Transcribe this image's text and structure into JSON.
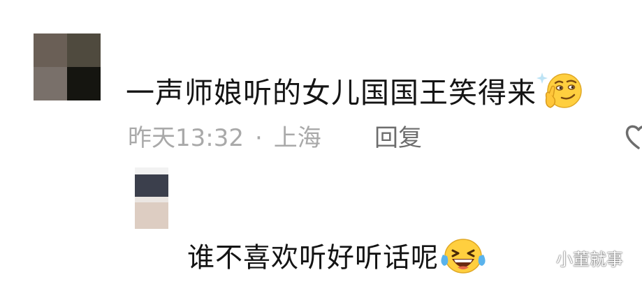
{
  "comment": {
    "avatar": {
      "icon": "pixelated-avatar",
      "pixels": [
        "#6a5f56",
        "#4f4a3e",
        "#79706a",
        "#151510"
      ]
    },
    "text": "一声师娘听的女儿国国王笑得来",
    "emoji": "smirk-thinking-emoji",
    "time": "昨天13:32",
    "separator": "·",
    "location": "上海",
    "reply_label": "回复",
    "like_icon": "heart-outline-icon"
  },
  "reply": {
    "avatar": {
      "icon": "blurred-avatar"
    },
    "text": "谁不喜欢听好听话呢",
    "emoji": "laughing-tears-emoji"
  },
  "watermark": {
    "text": "小董就事"
  },
  "colors": {
    "text_primary": "#141414",
    "text_meta": "#a9a9a9",
    "reply_link": "#6d6d6d",
    "emoji_yellow": "#ffcf3f"
  }
}
